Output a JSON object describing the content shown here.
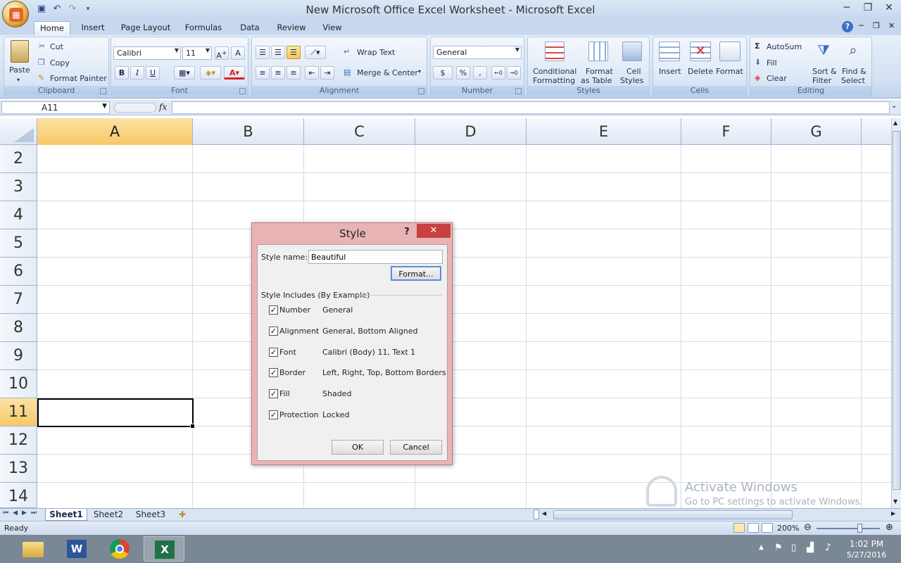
{
  "window": {
    "title": "New Microsoft Office Excel Worksheet - Microsoft Excel"
  },
  "tabs": [
    "Home",
    "Insert",
    "Page Layout",
    "Formulas",
    "Data",
    "Review",
    "View"
  ],
  "ribbon": {
    "clipboard": {
      "label": "Clipboard",
      "paste": "Paste",
      "cut": "Cut",
      "copy": "Copy",
      "format_painter": "Format Painter"
    },
    "font": {
      "label": "Font",
      "name": "Calibri",
      "size": "11",
      "bold": "B",
      "italic": "I",
      "underline": "U"
    },
    "alignment": {
      "label": "Alignment",
      "wrap_text": "Wrap Text",
      "merge_center": "Merge & Center"
    },
    "number": {
      "label": "Number",
      "format": "General",
      "currency": "$",
      "percent": "%",
      "comma": ","
    },
    "styles": {
      "label": "Styles",
      "conditional": [
        "Conditional",
        "Formatting"
      ],
      "format_table": [
        "Format",
        "as Table"
      ],
      "cell_styles": [
        "Cell",
        "Styles"
      ]
    },
    "cells": {
      "label": "Cells",
      "insert": "Insert",
      "delete": "Delete",
      "format": "Format"
    },
    "editing": {
      "label": "Editing",
      "autosum": "AutoSum",
      "fill": "Fill",
      "clear": "Clear",
      "sort": [
        "Sort &",
        "Filter"
      ],
      "find": [
        "Find &",
        "Select"
      ]
    }
  },
  "formula_bar": {
    "name_box": "A11",
    "fx": "fx",
    "formula": ""
  },
  "grid": {
    "columns": [
      "A",
      "B",
      "C",
      "D",
      "E",
      "F",
      "G"
    ],
    "rows": [
      "2",
      "3",
      "4",
      "5",
      "6",
      "7",
      "8",
      "9",
      "10",
      "11",
      "12",
      "13",
      "14"
    ],
    "selected_column": "A",
    "selected_row": "11"
  },
  "sheets": [
    "Sheet1",
    "Sheet2",
    "Sheet3"
  ],
  "status": {
    "text": "Ready",
    "zoom": "200%"
  },
  "watermark": {
    "line1": "Activate Windows",
    "line2": "Go to PC settings to activate Windows."
  },
  "clock": {
    "time": "1:02 PM",
    "date": "5/27/2016"
  },
  "dialog": {
    "title": "Style",
    "help": "?",
    "style_name_label": "Style name:",
    "style_name_value": "Beautiful",
    "format_button": "Format...",
    "includes_label": "Style Includes (By Example)",
    "options": [
      {
        "label": "Number",
        "value": "General",
        "checked": true
      },
      {
        "label": "Alignment",
        "value": "General, Bottom Aligned",
        "checked": true
      },
      {
        "label": "Font",
        "value": "Calibri (Body) 11, Text 1",
        "checked": true
      },
      {
        "label": "Border",
        "value": "Left, Right, Top, Bottom Borders",
        "checked": true
      },
      {
        "label": "Fill",
        "value": "Shaded",
        "checked": true
      },
      {
        "label": "Protection",
        "value": "Locked",
        "checked": true
      }
    ],
    "ok": "OK",
    "cancel": "Cancel"
  }
}
